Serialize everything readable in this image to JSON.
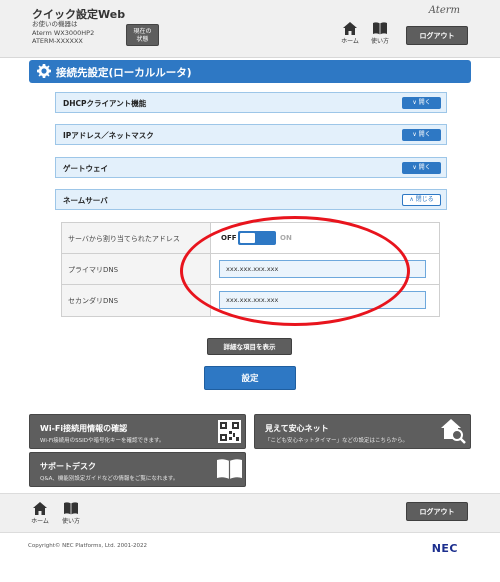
{
  "header": {
    "app_title": "クイック設定Web",
    "device_line1": "お使いの機器は",
    "device_line2": "Aterm  WX3000HP2",
    "device_line3": "ATERM-XXXXXX",
    "status_button_line1": "現在の",
    "status_button_line2": "状態",
    "logo": "Aterm",
    "home_label": "ホーム",
    "usage_label": "使い方",
    "logout_label": "ログアウト"
  },
  "section": {
    "title": "接続先設定(ローカルルータ)"
  },
  "accordions": [
    {
      "label": "DHCPクライアント機能",
      "button": "開く"
    },
    {
      "label": "IPアドレス／ネットマスク",
      "button": "開く"
    },
    {
      "label": "ゲートウェイ",
      "button": "開く"
    },
    {
      "label": "ネームサーバ",
      "button": "閉じる"
    }
  ],
  "form": {
    "auto_assign_label": "サーバから割り当てられたアドレス",
    "toggle_off_label": "OFF",
    "toggle_on_label": "ON",
    "toggle_state": "OFF",
    "primary_dns_label": "プライマリDNS",
    "primary_dns_value": "xxx.xxx.xxx.xxx",
    "secondary_dns_label": "セカンダリDNS",
    "secondary_dns_value": "xxx.xxx.xxx.xxx"
  },
  "actions": {
    "detail_label": "詳細な項目を表示",
    "save_label": "設定"
  },
  "tiles": {
    "wifi_title": "Wi-Fi接続用情報の確認",
    "wifi_desc": "Wi-Fi接続用のSSIDや暗号化キーを確認できます。",
    "safety_title": "見えて安心ネット",
    "safety_desc": "「こども安心ネットタイマー」などの設定はこちらから。",
    "support_title": "サポートデスク",
    "support_desc": "Q&A、機能別設定ガイドなどの情報をご覧になれます。"
  },
  "footer": {
    "home_label": "ホーム",
    "usage_label": "使い方",
    "logout_label": "ログアウト",
    "copyright": "Copyright© NEC Platforms, Ltd. 2001-2022",
    "brand": "NEC"
  },
  "colors": {
    "accent_blue": "#2e78c4",
    "dark_button": "#5e5e5e",
    "annotation_red": "#e8141d"
  }
}
